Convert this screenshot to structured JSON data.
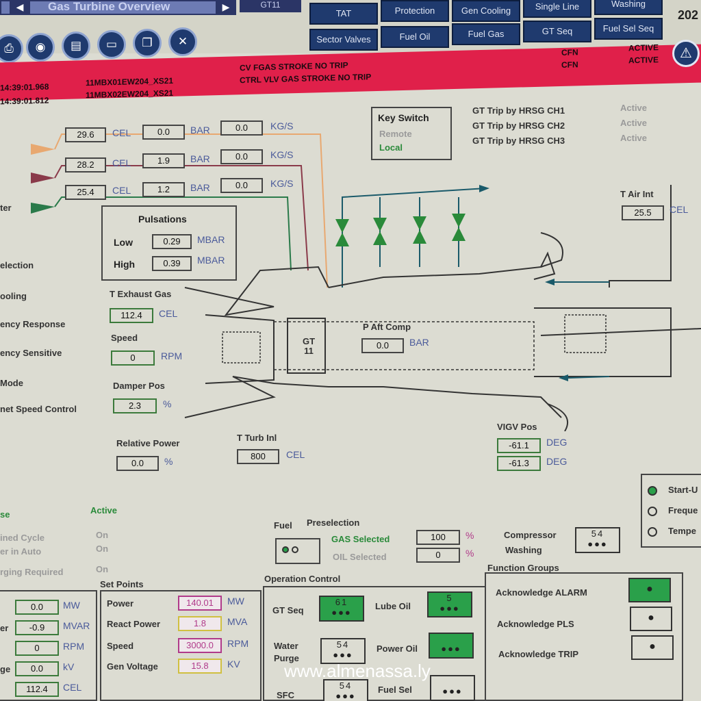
{
  "header": {
    "title": "Gas Turbine Overview",
    "gt_label": "GT11",
    "year": "202",
    "menu": [
      "TAT",
      "Protection",
      "Gen Cooling",
      "Single Line",
      "Washing",
      "Sector Valves",
      "Fuel Oil",
      "Fuel Gas",
      "GT Seq",
      "Fuel Sel Seq"
    ]
  },
  "alarms": [
    {
      "time": "14:39:01.968",
      "tag": "11MBX01EW204_XS21",
      "text": "CV FGAS STROKE NO TRIP",
      "code": "CFN",
      "state": "ACTIVE"
    },
    {
      "time": "14:39:01.812",
      "tag": "11MBX02EW204_XS21",
      "text": "CTRL VLV GAS STROKE NO TRIP",
      "code": "CFN",
      "state": "ACTIVE"
    }
  ],
  "inlet_rows": [
    {
      "cel": "29.6",
      "bar": "0.0",
      "kgs": "0.0"
    },
    {
      "cel": "28.2",
      "bar": "1.9",
      "kgs": "0.0"
    },
    {
      "cel": "25.4",
      "bar": "1.2",
      "kgs": "0.0"
    }
  ],
  "units": {
    "cel": "CEL",
    "bar": "BAR",
    "kgs": "KG/S",
    "mbar": "MBAR",
    "rpm": "RPM",
    "pct": "%",
    "deg": "DEG",
    "mw": "MW",
    "mvar": "MVAR",
    "mva": "MVA",
    "kv": "kV",
    "kvu": "KV"
  },
  "key_switch": {
    "title": "Key Switch",
    "remote": "Remote",
    "local": "Local"
  },
  "hrsg": [
    {
      "label": "GT Trip by HRSG CH1",
      "state": "Active"
    },
    {
      "label": "GT Trip by HRSG CH2",
      "state": "Active"
    },
    {
      "label": "GT Trip by HRSG CH3",
      "state": "Active"
    }
  ],
  "pulsations": {
    "title": "Pulsations",
    "low_label": "Low",
    "low": "0.29",
    "high_label": "High",
    "high": "0.39"
  },
  "left_labels": [
    "ter",
    "election",
    "ooling",
    "ency Response",
    "ency Sensitive",
    "Mode",
    "net Speed Control"
  ],
  "exhaust": {
    "label": "T Exhaust Gas",
    "value": "112.4"
  },
  "speed": {
    "label": "Speed",
    "value": "0"
  },
  "damper": {
    "label": "Damper Pos",
    "value": "2.3"
  },
  "rel_power": {
    "label": "Relative Power",
    "value": "0.0"
  },
  "turb_inl": {
    "label": "T Turb Inl",
    "value": "800"
  },
  "p_aft": {
    "label": "P Aft Comp",
    "value": "0.0"
  },
  "gt_core": "GT\n11",
  "t_air": {
    "label": "T Air Int",
    "value": "25.5"
  },
  "vigv": {
    "label": "VIGV Pos",
    "v1": "-61.1",
    "v2": "-61.3"
  },
  "status": {
    "se": "se",
    "active": "Active",
    "rows": [
      {
        "label": "ined Cycle",
        "val": "On"
      },
      {
        "label": "er in Auto",
        "val": "On"
      },
      {
        "label": "rging Required",
        "val": "On"
      }
    ]
  },
  "fuel": {
    "label": "Fuel",
    "presel": "Preselection",
    "gas": "GAS Selected",
    "gas_val": "100",
    "oil": "OIL Selected",
    "oil_val": "0"
  },
  "comp_wash": {
    "label1": "Compressor",
    "label2": "Washing",
    "num": "54"
  },
  "modes": [
    "Start-U",
    "Freque",
    "Tempe"
  ],
  "bottom_left": [
    {
      "label": "",
      "val": "0.0",
      "unit": "MW"
    },
    {
      "label": "er",
      "val": "-0.9",
      "unit": "MVAR"
    },
    {
      "label": "",
      "val": "0",
      "unit": "RPM"
    },
    {
      "label": "ge",
      "val": "0.0",
      "unit": "kV"
    },
    {
      "label": "",
      "val": "112.4",
      "unit": "CEL"
    }
  ],
  "setpoints": {
    "title": "Set Points",
    "rows": [
      {
        "label": "Power",
        "val": "140.01",
        "unit": "MW"
      },
      {
        "label": "React Power",
        "val": "1.8",
        "unit": "MVA"
      },
      {
        "label": "Speed",
        "val": "3000.0",
        "unit": "RPM"
      },
      {
        "label": "Gen Voltage",
        "val": "15.8",
        "unit": "KV"
      }
    ]
  },
  "opctrl": {
    "title": "Operation Control",
    "gtseq": "GT Seq",
    "gtseq_num": "61",
    "lube": "Lube Oil",
    "lube_num": "5",
    "water": "Water",
    "purge": "Purge",
    "water_num": "54",
    "power_oil": "Power Oil",
    "sfc": "SFC",
    "sfc_num": "54",
    "fuel_sel": "Fuel Sel"
  },
  "func": {
    "title": "Function Groups",
    "alarm": "Acknowledge ALARM",
    "pls": "Acknowledge PLS",
    "trip": "Acknowledge TRIP"
  },
  "watermark": "www.almenassa.ly",
  "colors": {
    "accent": "#1f3a6e",
    "alarm": "#e0204a",
    "ok": "#2aa04a",
    "unit": "#4a5a9a"
  }
}
